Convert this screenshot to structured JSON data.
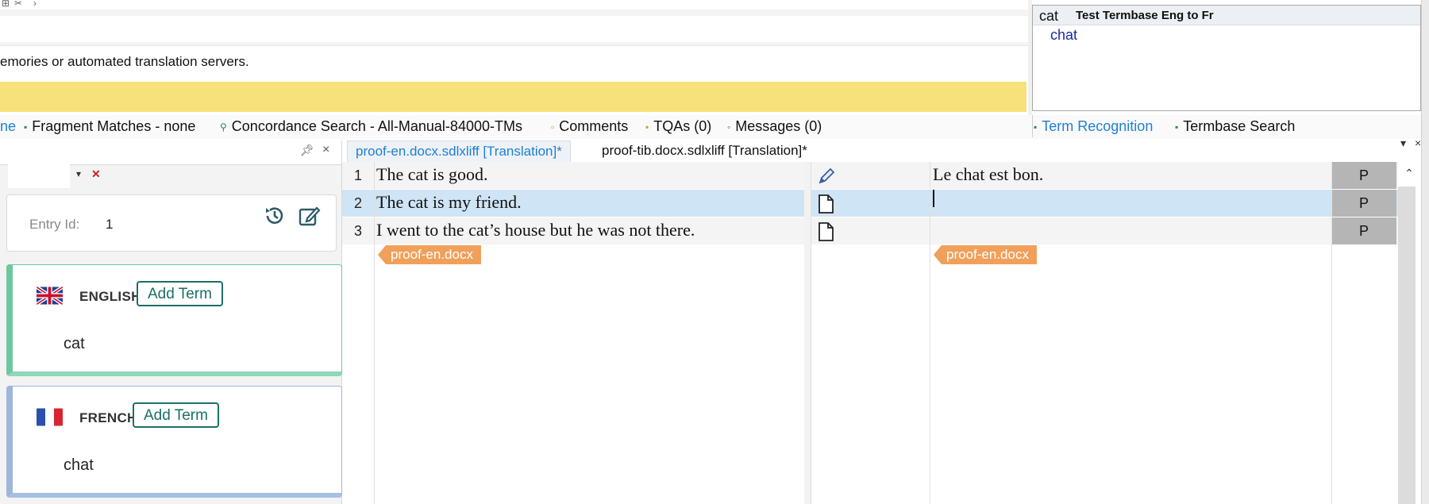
{
  "top": {
    "info_text": "emories or automated translation servers."
  },
  "termbase_panel": {
    "source_term": "cat",
    "termbase_name": "Test Termbase Eng to Fr",
    "target_term": "chat"
  },
  "tabs": {
    "partial": "ne",
    "fragment_matches": "Fragment Matches - none",
    "concordance": "Concordance Search - All-Manual-84000-TMs",
    "comments": "Comments",
    "tqas": "TQAs (0)",
    "messages": "Messages (0)",
    "term_recognition": "Term Recognition",
    "termbase_search": "Termbase Search"
  },
  "entry": {
    "label": "Entry Id:",
    "value": "1"
  },
  "english": {
    "language": "ENGLISH",
    "add_term": "Add Term",
    "term": "cat"
  },
  "french": {
    "language": "FRENCH",
    "add_term": "Add Term",
    "term": "chat"
  },
  "editor": {
    "doc_tabs": [
      "proof-en.docx.sdlxliff [Translation]*",
      "proof-tib.docx.sdlxliff [Translation]*"
    ],
    "rows": [
      {
        "num": "1",
        "source": "The cat is good.",
        "target": "Le chat est bon.",
        "status": "P"
      },
      {
        "num": "2",
        "source": "The cat is my friend.",
        "target": "",
        "status": "P"
      },
      {
        "num": "3",
        "source": "I went to the cat’s house but he was not there.",
        "target": "",
        "status": "P"
      }
    ],
    "doc_tag_source": "proof-en.docx",
    "doc_tag_target": "proof-en.docx"
  },
  "colors": {
    "accent_blue": "#1e7fd6",
    "highlight_row": "#cfe4f5",
    "yellow_bar": "#f7e17b",
    "english_border": "#6fc7a2",
    "french_border": "#9fb6d8",
    "doc_tag": "#f0a05a",
    "add_term_teal": "#1b6f66"
  },
  "icons": [
    "pin-icon",
    "close-icon",
    "history-icon",
    "edit-icon",
    "pencil-icon",
    "document-icon",
    "chevron-up-icon"
  ]
}
